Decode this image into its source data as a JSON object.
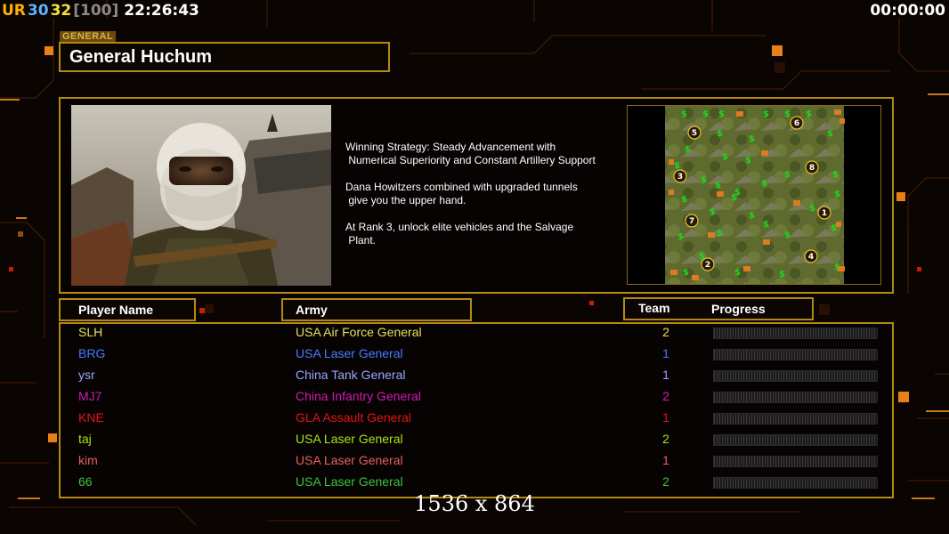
{
  "hud": {
    "ur_label": "UR",
    "num_a": "30",
    "num_b": "32",
    "num_c": "[100]",
    "clock": "22:26:43",
    "timer": "00:00:00"
  },
  "general": {
    "tag": "GENERAL",
    "name": "General Huchum"
  },
  "strategy": {
    "line1": "Winning Strategy: Steady Advancement with\n Numerical Superiority and Constant Artillery Support",
    "line2": "Dana Howitzers combined with upgraded tunnels\n give you the upper hand.",
    "line3": "At Rank 3, unlock elite vehicles and the Salvage\n Plant."
  },
  "minimap": {
    "start_positions": [
      "1",
      "2",
      "3",
      "4",
      "5",
      "6",
      "7",
      "8"
    ]
  },
  "columns": {
    "player_name": "Player Name",
    "army": "Army",
    "team": "Team",
    "progress": "Progress"
  },
  "players": [
    {
      "name": "SLH",
      "army": "USA Air Force General",
      "team": "2",
      "color": "#e8e05a",
      "progress": 0
    },
    {
      "name": "BRG",
      "army": "USA Laser General",
      "team": "1",
      "color": "#4a7aff",
      "progress": 0
    },
    {
      "name": "ysr",
      "army": "China Tank General",
      "team": "1",
      "color": "#9aa6ff",
      "progress": 0
    },
    {
      "name": "MJ7",
      "army": "China Infantry General",
      "team": "2",
      "color": "#d21ab4",
      "progress": 0
    },
    {
      "name": "KNE",
      "army": "GLA Assault General",
      "team": "1",
      "color": "#e8141a",
      "progress": 0
    },
    {
      "name": "taj",
      "army": "USA Laser General",
      "team": "2",
      "color": "#a8e614",
      "progress": 0
    },
    {
      "name": "kim",
      "army": "USA Laser General",
      "team": "1",
      "color": "#e86060",
      "progress": 0
    },
    {
      "name": "66",
      "army": "USA Laser General",
      "team": "2",
      "color": "#3ec43e",
      "progress": 0
    }
  ],
  "resolution_label": "1536 x 864",
  "colors": {
    "frame": "#b48a12",
    "ur": "#ffb000",
    "num_a": "#5fb4ff",
    "num_b": "#f2e33a",
    "num_c": "#8a8a8a"
  }
}
